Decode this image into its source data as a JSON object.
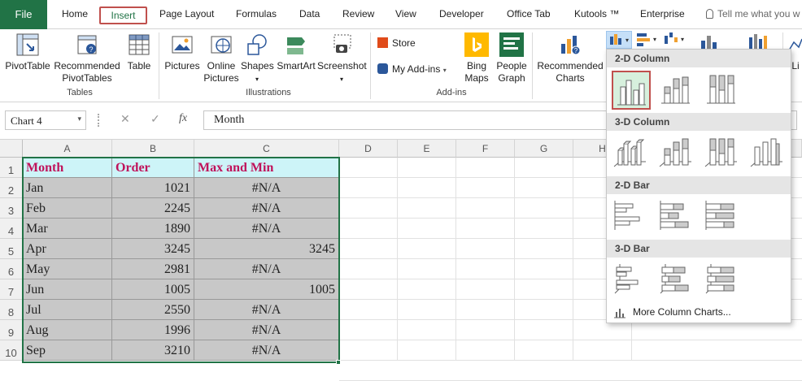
{
  "tabs": {
    "file": "File",
    "home": "Home",
    "insert": "Insert",
    "page_layout": "Page Layout",
    "formulas": "Formulas",
    "data": "Data",
    "review": "Review",
    "view": "View",
    "developer": "Developer",
    "office_tab": "Office Tab",
    "kutools": "Kutools ™",
    "enterprise": "Enterprise",
    "tell_me": "Tell me what you w"
  },
  "ribbon": {
    "pivottable": "PivotTable",
    "rec_pivot_1": "Recommended",
    "rec_pivot_2": "PivotTables",
    "table": "Table",
    "tables_group": "Tables",
    "pictures": "Pictures",
    "online_1": "Online",
    "online_2": "Pictures",
    "shapes": "Shapes",
    "smartart": "SmartArt",
    "screenshot": "Screenshot",
    "illustrations_group": "Illustrations",
    "store": "Store",
    "my_addins": "My Add-ins",
    "bing_1": "Bing",
    "bing_2": "Maps",
    "people_1": "People",
    "people_2": "Graph",
    "addins_group": "Add-ins",
    "rec_charts_1": "Recommended",
    "rec_charts_2": "Charts",
    "li": "Li"
  },
  "formula_bar": {
    "name_box": "Chart 4",
    "formula": "Month"
  },
  "sheet": {
    "columns": [
      "A",
      "B",
      "C",
      "D",
      "E",
      "F",
      "G",
      "H"
    ],
    "rows": [
      "1",
      "2",
      "3",
      "4",
      "5",
      "6",
      "7",
      "8",
      "9",
      "10"
    ],
    "header": [
      "Month",
      "Order",
      "Max and Min"
    ],
    "data": [
      [
        "Jan",
        "1021",
        "#N/A"
      ],
      [
        "Feb",
        "2245",
        "#N/A"
      ],
      [
        "Mar",
        "1890",
        "#N/A"
      ],
      [
        "Apr",
        "3245",
        "3245"
      ],
      [
        "May",
        "2981",
        "#N/A"
      ],
      [
        "Jun",
        "1005",
        "1005"
      ],
      [
        "Jul",
        "2550",
        "#N/A"
      ],
      [
        "Aug",
        "1996",
        "#N/A"
      ],
      [
        "Sep",
        "3210",
        "#N/A"
      ]
    ]
  },
  "dropdown": {
    "section_2d_col": "2-D Column",
    "section_3d_col": "3-D Column",
    "section_2d_bar": "2-D Bar",
    "section_3d_bar": "3-D Bar",
    "more": "More Column Charts..."
  },
  "colors": {
    "excel_green": "#217346",
    "header_text": "#c0135b",
    "header_fill": "#cdf4f8",
    "data_fill": "#c8c8c8",
    "highlight": "#c0504d"
  }
}
